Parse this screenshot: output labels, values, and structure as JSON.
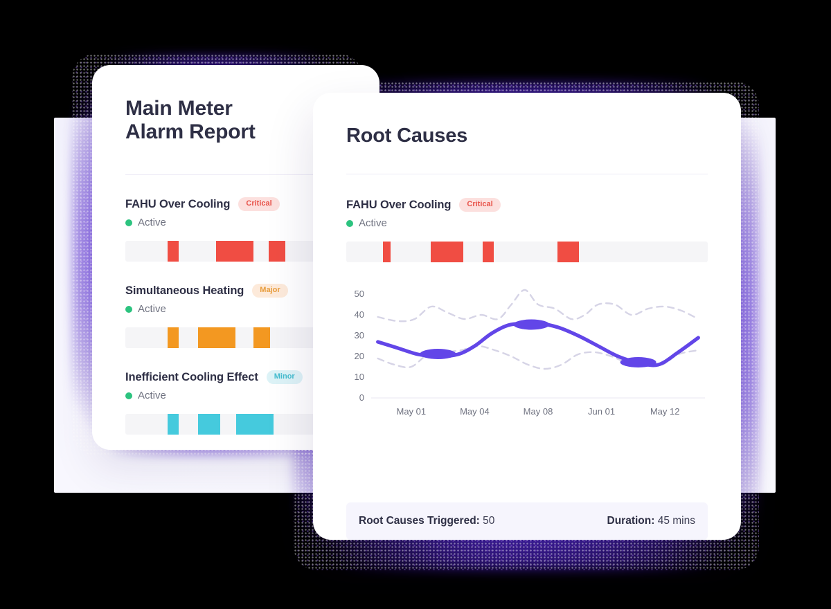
{
  "theme": {
    "page_background": "#000000",
    "card_background": "#ffffff",
    "accent_purple": "#6246e8",
    "glow_purple": "#5a2ddc",
    "backdrop_lavender": "#f4f3fd",
    "text_dark": "#2e2f45",
    "text_muted": "#6f7280",
    "divider": "#eceaf6",
    "track": "#f5f5f7",
    "status_active": "#2cc37f",
    "severity_critical": "#f04d43",
    "severity_major": "#f39821",
    "severity_minor": "#45cadd",
    "summary_background": "#f6f5fd"
  },
  "left_card": {
    "title_line1": "Main Meter",
    "title_line2": "Alarm Report",
    "alarms": [
      {
        "name": "FAHU Over Cooling",
        "severity": "Critical",
        "severity_key": "critical",
        "status": "Active",
        "segments": [
          {
            "left_pct": 19.0,
            "width_pct": 5.0
          },
          {
            "left_pct": 41.0,
            "width_pct": 17.0
          },
          {
            "left_pct": 65.0,
            "width_pct": 7.5
          }
        ]
      },
      {
        "name": "Simultaneous Heating",
        "severity": "Major",
        "severity_key": "major",
        "status": "Active",
        "segments": [
          {
            "left_pct": 19.0,
            "width_pct": 5.0
          },
          {
            "left_pct": 33.0,
            "width_pct": 17.0
          },
          {
            "left_pct": 58.0,
            "width_pct": 7.5
          }
        ]
      },
      {
        "name": "Inefficient Cooling Effect",
        "severity": "Minor",
        "severity_key": "minor",
        "status": "Active",
        "segments": [
          {
            "left_pct": 19.0,
            "width_pct": 5.0
          },
          {
            "left_pct": 33.0,
            "width_pct": 10.0
          },
          {
            "left_pct": 50.0,
            "width_pct": 17.0
          }
        ]
      }
    ]
  },
  "right_card": {
    "title": "Root Causes",
    "alarm": {
      "name": "FAHU Over Cooling",
      "severity": "Critical",
      "severity_key": "critical",
      "status": "Active",
      "segments": [
        {
          "left_pct": 10.2,
          "width_pct": 2.0
        },
        {
          "left_pct": 23.4,
          "width_pct": 9.0
        },
        {
          "left_pct": 37.8,
          "width_pct": 3.0
        },
        {
          "left_pct": 58.4,
          "width_pct": 6.0
        }
      ]
    },
    "summary": {
      "root_causes_label": "Root Causes Triggered:",
      "root_causes_value": "50",
      "duration_label": "Duration:",
      "duration_value": "45 mins"
    }
  },
  "chart_data": {
    "type": "line",
    "title": "",
    "xlabel": "",
    "ylabel": "",
    "ylim": [
      0,
      52
    ],
    "yticks": [
      0,
      10,
      20,
      30,
      40,
      50
    ],
    "grid": false,
    "legend": "none",
    "categories": [
      "May 01",
      "May 04",
      "May 08",
      "Jun 01",
      "May 12"
    ],
    "x_tick_positions_pct": [
      12,
      31,
      50,
      69,
      88
    ],
    "series": [
      {
        "name": "Root causes trend",
        "style": "solid-thick-variable",
        "color": "#6246e8",
        "x_pct": [
          2,
          8,
          14,
          20,
          26,
          31,
          36,
          41,
          46,
          50,
          56,
          62,
          68,
          74,
          80,
          86,
          92,
          98
        ],
        "values": [
          27,
          24,
          21,
          20,
          21,
          25,
          31,
          35,
          36,
          36,
          34,
          30,
          25,
          20,
          17,
          16,
          22,
          29,
          33
        ],
        "bulges": [
          {
            "x_pct": 20,
            "y": 20.5,
            "kind": "trough"
          },
          {
            "x_pct": 48,
            "y": 36.0,
            "kind": "peak"
          },
          {
            "x_pct": 80,
            "y": 16.5,
            "kind": "trough"
          }
        ]
      },
      {
        "name": "Upper envelope",
        "style": "dashed",
        "color": "#d6d4e6",
        "x_pct": [
          2,
          8,
          13,
          18,
          23,
          28,
          33,
          38,
          42,
          46,
          50,
          55,
          60,
          64,
          68,
          73,
          78,
          83,
          88,
          93,
          98
        ],
        "values": [
          39,
          37,
          38,
          44,
          41,
          38,
          40,
          38,
          45,
          52,
          45,
          43,
          38,
          40,
          45,
          45,
          40,
          43,
          44,
          42,
          38
        ]
      },
      {
        "name": "Lower envelope",
        "style": "dashed",
        "color": "#d6d4e6",
        "x_pct": [
          2,
          7,
          12,
          17,
          22,
          27,
          32,
          37,
          42,
          47,
          52,
          57,
          62,
          67,
          72,
          77,
          82,
          87,
          92,
          98
        ],
        "values": [
          19,
          16,
          15,
          21,
          22,
          23,
          25,
          23,
          20,
          16,
          14,
          16,
          21,
          22,
          20,
          17,
          18,
          16,
          21,
          23
        ]
      }
    ]
  }
}
